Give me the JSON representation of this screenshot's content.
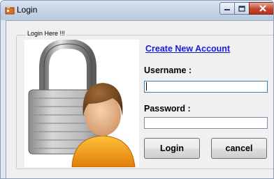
{
  "window": {
    "title": "Login",
    "icon": "app-icon",
    "controls": [
      "minimize-icon",
      "maximize-icon",
      "close-icon"
    ]
  },
  "group": {
    "title": "Login Here !!!"
  },
  "image": {
    "icon": "padlock-user-icon"
  },
  "link": {
    "create_account": "Create New Account"
  },
  "form": {
    "username_label": "Username :",
    "username_value": "",
    "password_label": "Password :",
    "password_value": ""
  },
  "buttons": {
    "login": "Login",
    "cancel": "cancel"
  },
  "colors": {
    "link": "#1a1add",
    "close_button": "#c7452f",
    "titlebar": "#c7d4e6"
  }
}
